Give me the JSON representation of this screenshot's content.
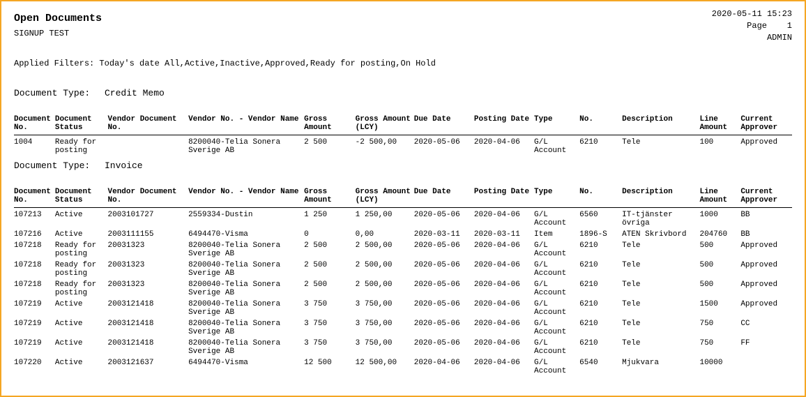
{
  "header": {
    "title": "Open Documents",
    "timestamp": "2020-05-11 15:23",
    "page_label": "Page",
    "page_number": "1",
    "tenant": "SIGNUP TEST",
    "user": "ADMIN"
  },
  "filters": {
    "label": "Applied Filters:",
    "value": "Today's date All,Active,Inactive,Approved,Ready for posting,On Hold"
  },
  "columns": {
    "doc_no": "Document No.",
    "doc_status": "Document Status",
    "vendor_doc_no": "Vendor Document No.",
    "vendor": "Vendor No. - Vendor Name",
    "gross": "Gross Amount",
    "gross_lcy": "Gross Amount (LCY)",
    "due_date": "Due Date",
    "posting_date": "Posting Date",
    "type": "Type",
    "no": "No.",
    "description": "Description",
    "line_amount": "Line Amount",
    "approver": "Current Approver"
  },
  "sections": [
    {
      "doc_type_label": "Document Type:",
      "doc_type_value": "Credit Memo",
      "rows": [
        {
          "doc_no": "1004",
          "doc_status": "Ready for posting",
          "vendor_doc_no": "",
          "vendor": "8200040-Telia Sonera Sverige AB",
          "gross": "2 500",
          "gross_lcy": "-2 500,00",
          "due_date": "2020-05-06",
          "posting_date": "2020-04-06",
          "type": "G/L Account",
          "no": "6210",
          "description": "Tele",
          "line_amount": "100",
          "approver": "Approved"
        }
      ]
    },
    {
      "doc_type_label": "Document Type:",
      "doc_type_value": "Invoice",
      "rows": [
        {
          "doc_no": "107213",
          "doc_status": "Active",
          "vendor_doc_no": "2003101727",
          "vendor": "2559334-Dustin",
          "gross": "1 250",
          "gross_lcy": "1 250,00",
          "due_date": "2020-05-06",
          "posting_date": "2020-04-06",
          "type": "G/L Account",
          "no": "6560",
          "description": "IT-tjänster övriga",
          "line_amount": "1000",
          "approver": "BB"
        },
        {
          "doc_no": "107216",
          "doc_status": "Active",
          "vendor_doc_no": "2003111155",
          "vendor": "6494470-Visma",
          "gross": "0",
          "gross_lcy": "0,00",
          "due_date": "2020-03-11",
          "posting_date": "2020-03-11",
          "type": "Item",
          "no": "1896-S",
          "description": "ATEN Skrivbord",
          "line_amount": "204760",
          "approver": "BB"
        },
        {
          "doc_no": "107218",
          "doc_status": "Ready for posting",
          "vendor_doc_no": "20031323",
          "vendor": "8200040-Telia Sonera Sverige AB",
          "gross": "2 500",
          "gross_lcy": "2 500,00",
          "due_date": "2020-05-06",
          "posting_date": "2020-04-06",
          "type": "G/L Account",
          "no": "6210",
          "description": "Tele",
          "line_amount": "500",
          "approver": "Approved"
        },
        {
          "doc_no": "107218",
          "doc_status": "Ready for posting",
          "vendor_doc_no": "20031323",
          "vendor": "8200040-Telia Sonera Sverige AB",
          "gross": "2 500",
          "gross_lcy": "2 500,00",
          "due_date": "2020-05-06",
          "posting_date": "2020-04-06",
          "type": "G/L Account",
          "no": "6210",
          "description": "Tele",
          "line_amount": "500",
          "approver": "Approved"
        },
        {
          "doc_no": "107218",
          "doc_status": "Ready for posting",
          "vendor_doc_no": "20031323",
          "vendor": "8200040-Telia Sonera Sverige AB",
          "gross": "2 500",
          "gross_lcy": "2 500,00",
          "due_date": "2020-05-06",
          "posting_date": "2020-04-06",
          "type": "G/L Account",
          "no": "6210",
          "description": "Tele",
          "line_amount": "500",
          "approver": "Approved"
        },
        {
          "doc_no": "107219",
          "doc_status": "Active",
          "vendor_doc_no": "2003121418",
          "vendor": "8200040-Telia Sonera Sverige AB",
          "gross": "3 750",
          "gross_lcy": "3 750,00",
          "due_date": "2020-05-06",
          "posting_date": "2020-04-06",
          "type": "G/L Account",
          "no": "6210",
          "description": "Tele",
          "line_amount": "1500",
          "approver": "Approved"
        },
        {
          "doc_no": "107219",
          "doc_status": "Active",
          "vendor_doc_no": "2003121418",
          "vendor": "8200040-Telia Sonera Sverige AB",
          "gross": "3 750",
          "gross_lcy": "3 750,00",
          "due_date": "2020-05-06",
          "posting_date": "2020-04-06",
          "type": "G/L Account",
          "no": "6210",
          "description": "Tele",
          "line_amount": "750",
          "approver": "CC"
        },
        {
          "doc_no": "107219",
          "doc_status": "Active",
          "vendor_doc_no": "2003121418",
          "vendor": "8200040-Telia Sonera Sverige AB",
          "gross": "3 750",
          "gross_lcy": "3 750,00",
          "due_date": "2020-05-06",
          "posting_date": "2020-04-06",
          "type": "G/L Account",
          "no": "6210",
          "description": "Tele",
          "line_amount": "750",
          "approver": "FF"
        },
        {
          "doc_no": "107220",
          "doc_status": "Active",
          "vendor_doc_no": "2003121637",
          "vendor": "6494470-Visma",
          "gross": "12 500",
          "gross_lcy": "12 500,00",
          "due_date": "2020-04-06",
          "posting_date": "2020-04-06",
          "type": "G/L Account",
          "no": "6540",
          "description": "Mjukvara",
          "line_amount": "10000",
          "approver": ""
        }
      ]
    }
  ]
}
